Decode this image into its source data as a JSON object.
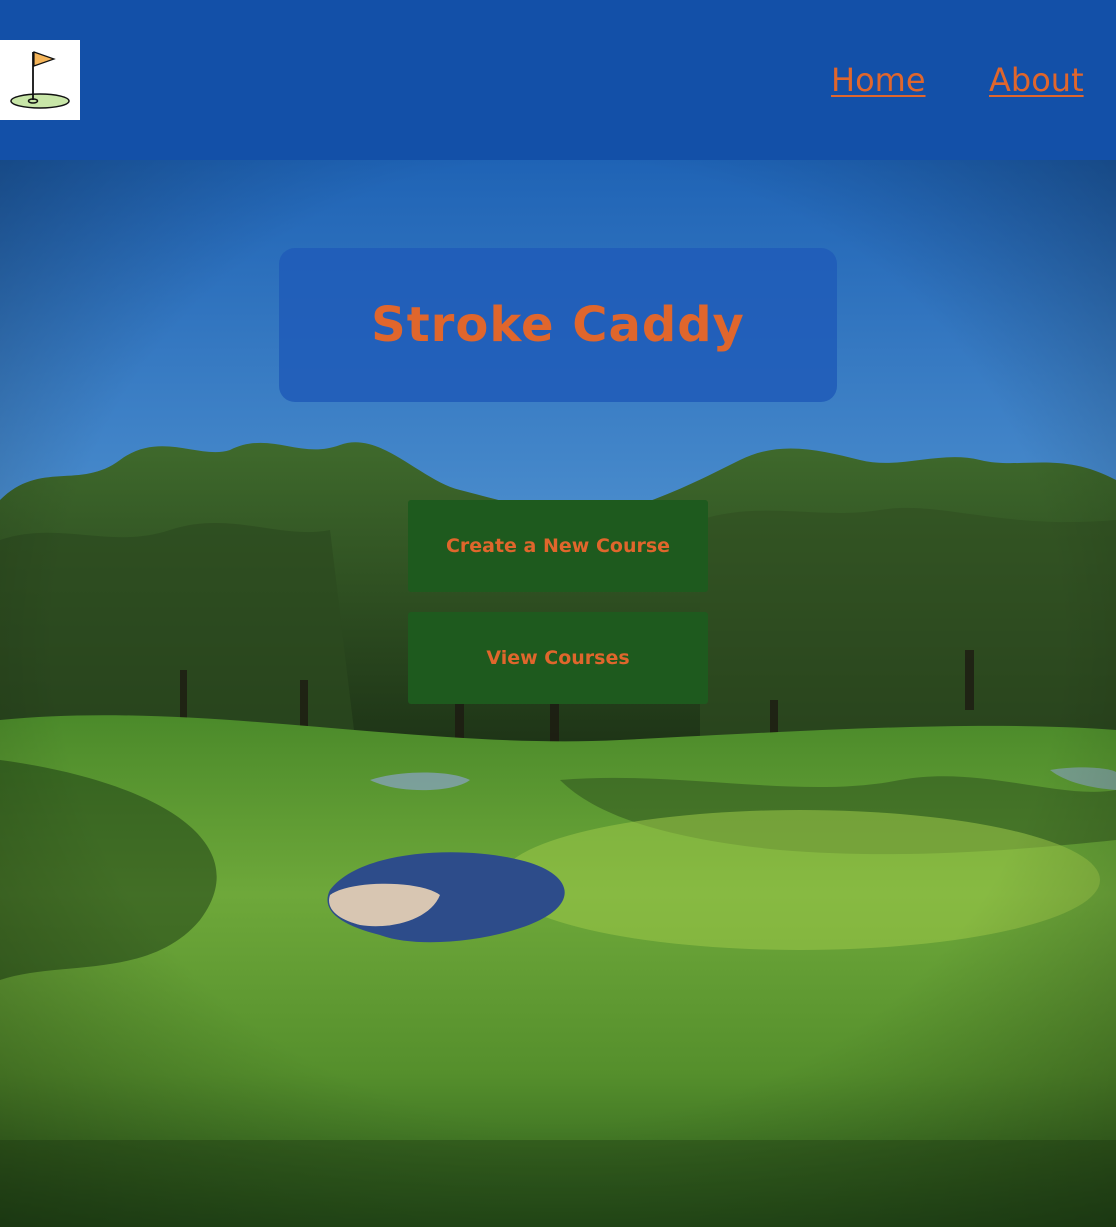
{
  "header": {
    "logo_icon": "golf-flag-icon",
    "nav": [
      {
        "label": "Home"
      },
      {
        "label": "About"
      }
    ]
  },
  "hero": {
    "title": "Stroke Caddy",
    "background": "golf-course-photo",
    "buttons": [
      {
        "label": "Create a New Course"
      },
      {
        "label": "View Courses"
      }
    ]
  },
  "colors": {
    "navbar": "#1350a8",
    "accent": "#e0662c",
    "button": "#1e5a1e",
    "title_box": "#205cb8"
  }
}
